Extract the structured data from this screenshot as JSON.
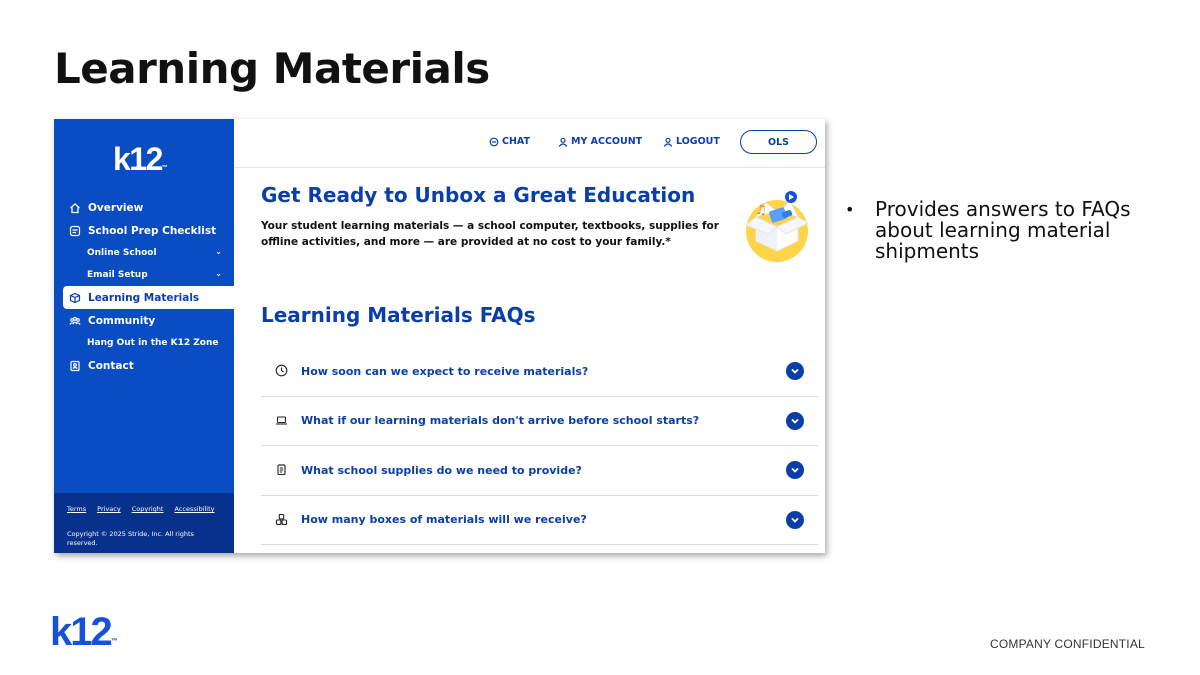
{
  "slide": {
    "title": "Learning Materials",
    "bullets": [
      "Provides answers to FAQs about learning material shipments"
    ],
    "footer_confidential": "COMPANY CONFIDENTIAL",
    "brand_logo": "k12",
    "brand_tm": "™"
  },
  "app": {
    "sidebar": {
      "logo": "k12",
      "logo_tm": "™",
      "items": [
        {
          "label": "Overview",
          "icon": "home-icon"
        },
        {
          "label": "School Prep Checklist",
          "icon": "checklist-icon"
        },
        {
          "label": "Online School",
          "icon": "",
          "chevron": "⌄"
        },
        {
          "label": "Email Setup",
          "icon": "",
          "chevron": "⌄"
        },
        {
          "label": "Learning Materials",
          "icon": "box-icon"
        },
        {
          "label": "Community",
          "icon": "people-icon"
        },
        {
          "label": "Hang Out in the K12 Zone",
          "icon": ""
        },
        {
          "label": "Contact",
          "icon": "contact-icon"
        }
      ],
      "footer_links": [
        "Terms",
        "Privacy",
        "Copyright",
        "Accessibility"
      ],
      "copyright": "Copyright © 2025 Stride, Inc. All rights reserved."
    },
    "topbar": {
      "chat": "CHAT",
      "my_account": "MY ACCOUNT",
      "logout": "LOGOUT",
      "ols": "OLS"
    },
    "hero": {
      "title": "Get Ready to Unbox a Great Education",
      "text": "Your student learning materials — a school computer, textbooks, supplies for offline activities, and more — are provided at no cost to your family.*"
    },
    "faq": {
      "title": "Learning Materials FAQs",
      "items": [
        {
          "question": "How soon can we expect to receive materials?",
          "icon": "clock-icon"
        },
        {
          "question": "What if our learning materials don't arrive before school starts?",
          "icon": "laptop-icon"
        },
        {
          "question": "What school supplies do we need to provide?",
          "icon": "notepad-icon"
        },
        {
          "question": "How many boxes of materials will we receive?",
          "icon": "boxes-icon"
        }
      ]
    },
    "colors": {
      "sidebar": "#0a4dc2",
      "accent": "#0a3ea8",
      "brand": "#1651d8"
    }
  }
}
